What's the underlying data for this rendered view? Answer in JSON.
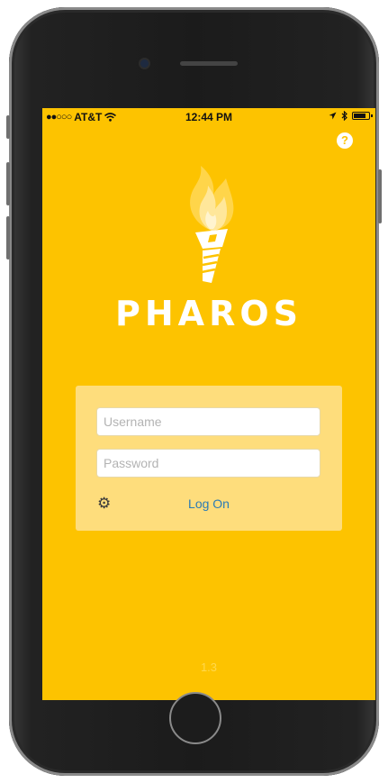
{
  "status_bar": {
    "carrier": "AT&T",
    "time": "12:44 PM",
    "signal_icon": "signal-dots-icon",
    "wifi_icon": "wifi-icon",
    "location_icon": "location-arrow-icon",
    "bluetooth_icon": "bluetooth-icon",
    "battery_icon": "battery-icon"
  },
  "help": {
    "label": "?",
    "icon": "question-circle-icon"
  },
  "logo": {
    "icon": "torch-icon",
    "brand": "PHAROS"
  },
  "login": {
    "username_placeholder": "Username",
    "password_placeholder": "Password",
    "settings_icon": "gear-icon",
    "logon_label": "Log On"
  },
  "version": "1.3",
  "colors": {
    "background": "#fdc300",
    "panel": "#fedd7c",
    "link": "#2b7bb5",
    "brand_text": "#ffffff"
  }
}
